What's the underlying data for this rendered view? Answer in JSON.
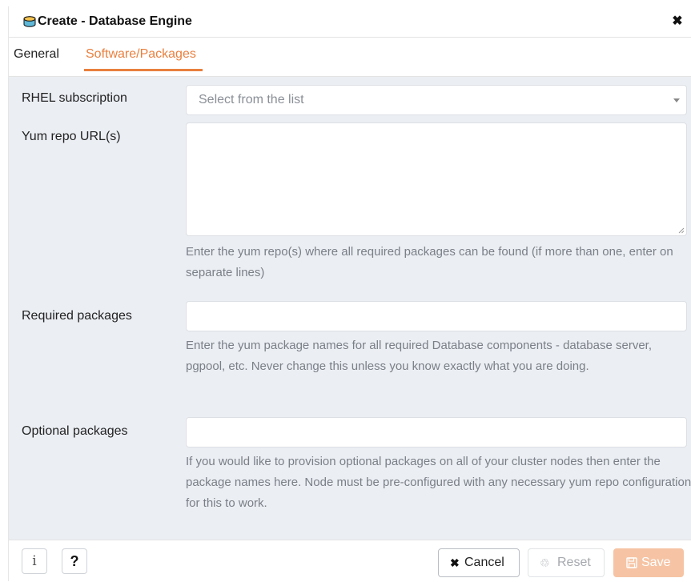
{
  "dialog": {
    "title": "Create - Database Engine",
    "title_icon": "database-icon",
    "close_icon": "close-icon",
    "close_glyph": "✖"
  },
  "tabs": [
    {
      "label": "General",
      "active": false
    },
    {
      "label": "Software/Packages",
      "active": true
    }
  ],
  "form": {
    "rhel_subscription": {
      "label": "RHEL subscription",
      "placeholder": "Select from the list",
      "value": ""
    },
    "yum_repo_urls": {
      "label": "Yum repo URL(s)",
      "value": "",
      "help": "Enter the yum repo(s) where all required packages can be found (if more than one, enter on separate lines)"
    },
    "required_packages": {
      "label": "Required packages",
      "value": "",
      "help": "Enter the yum package names for all required Database components - database server, pgpool, etc. Never change this unless you know exactly what you are doing."
    },
    "optional_packages": {
      "label": "Optional packages",
      "value": "",
      "help": "If you would like to provision optional packages on all of your cluster nodes then enter the package names here. Node must be pre-configured with any necessary yum repo configuration for this to work."
    }
  },
  "footer": {
    "info_glyph": "i",
    "help_glyph": "?",
    "cancel": {
      "label": "Cancel",
      "glyph": "✖",
      "icon": "close-icon"
    },
    "reset": {
      "label": "Reset",
      "glyph": "♲",
      "icon": "recycle-icon",
      "enabled": false
    },
    "save": {
      "label": "Save",
      "glyph": "🖫",
      "icon": "save-icon",
      "enabled": false
    }
  },
  "colors": {
    "accent": "#e97f3d",
    "body_bg": "#ebeef3",
    "save_disabled": "#f6c4a4",
    "help_text": "#7a7f87"
  }
}
